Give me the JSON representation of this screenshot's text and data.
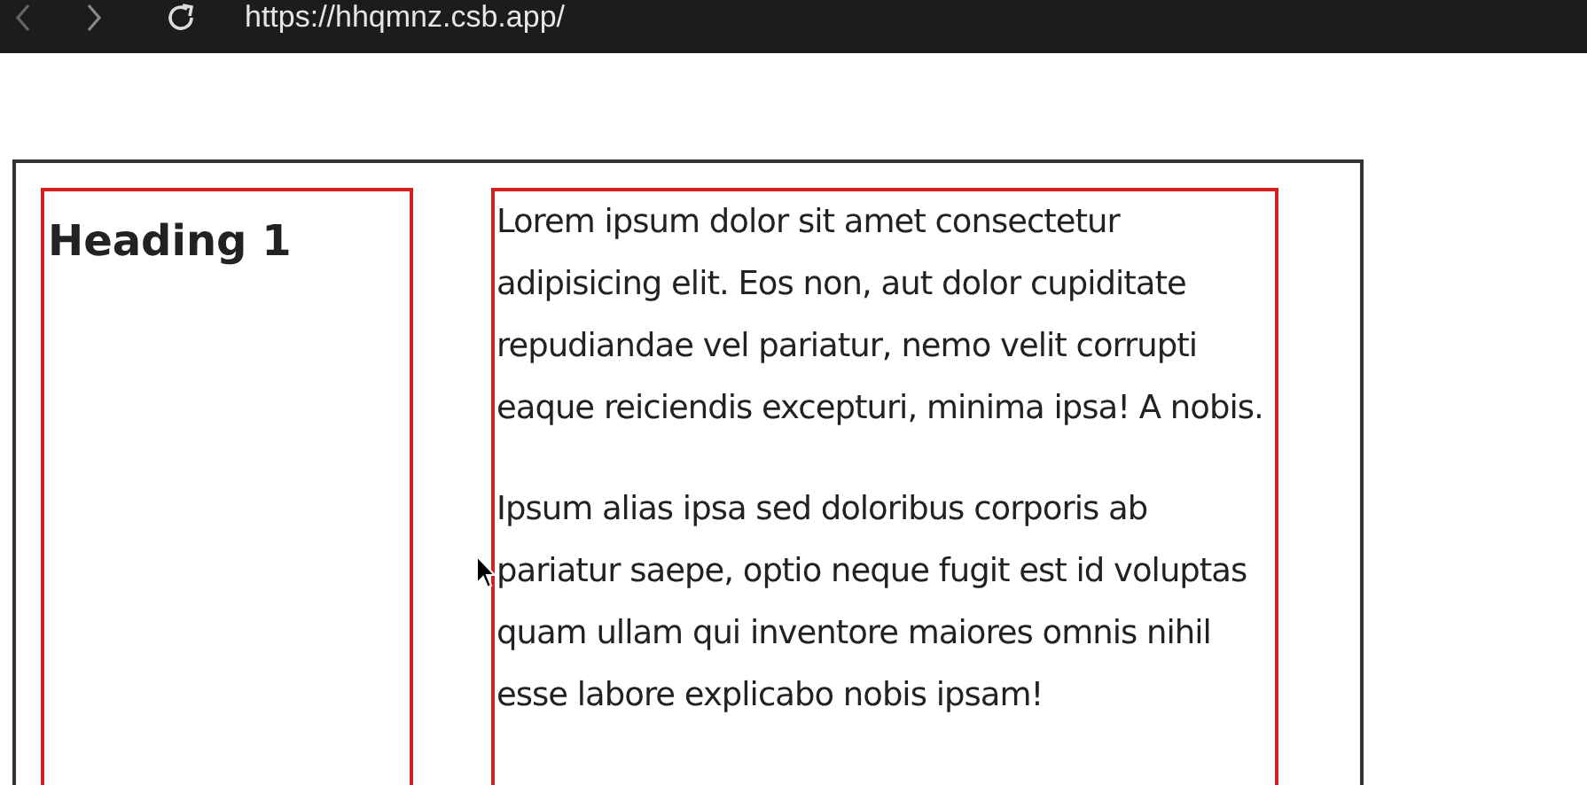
{
  "browser": {
    "url": "https://hhqmnz.csb.app/"
  },
  "heading": "Heading 1",
  "paragraphs": [
    "Lorem ipsum dolor sit amet consectetur adipisicing elit. Eos non, aut dolor cupiditate repudiandae vel pariatur, nemo velit corrupti eaque reiciendis excepturi, minima ipsa! A nobis.",
    "Ipsum alias ipsa sed doloribus corporis ab pariatur saepe, optio neque fugit est id voluptas quam ullam qui inventore maiores omnis nihil esse labore explicabo nobis ipsam!"
  ]
}
